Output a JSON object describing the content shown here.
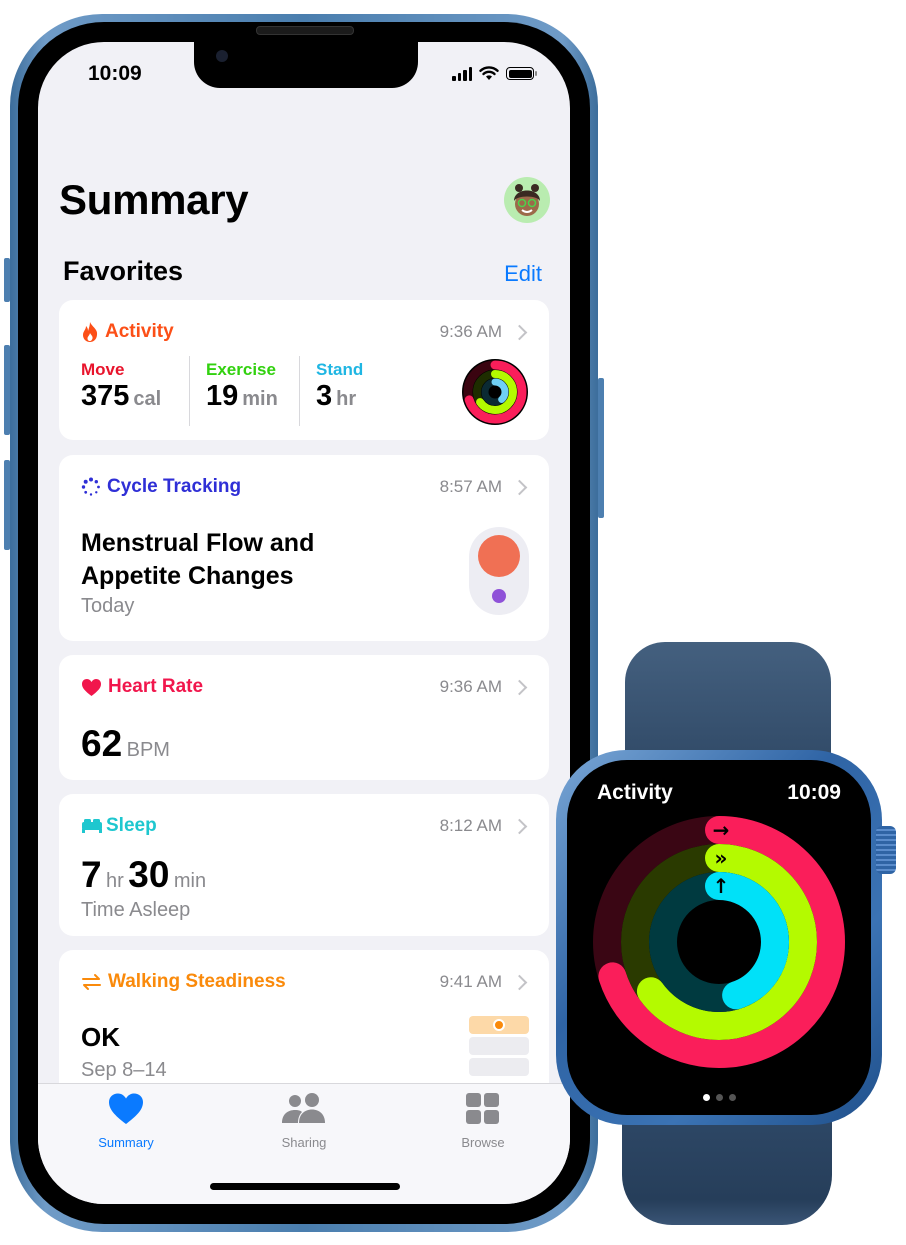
{
  "status_bar": {
    "time": "10:09"
  },
  "header": {
    "title": "Summary"
  },
  "favorites": {
    "label": "Favorites",
    "edit_label": "Edit"
  },
  "cards": {
    "activity": {
      "title": "Activity",
      "time": "9:36 AM",
      "color": "#fc4f17",
      "move": {
        "label": "Move",
        "value": "375",
        "unit": "cal",
        "color": "#e8142c"
      },
      "exercise": {
        "label": "Exercise",
        "value": "19",
        "unit": "min",
        "color": "#32d10f"
      },
      "stand": {
        "label": "Stand",
        "value": "3",
        "unit": "hr",
        "color": "#1fb6e3"
      }
    },
    "cycle": {
      "title": "Cycle Tracking",
      "time": "8:57 AM",
      "color": "#2f2fd6",
      "line1": "Menstrual Flow and",
      "line2": "Appetite Changes",
      "date": "Today"
    },
    "heart": {
      "title": "Heart Rate",
      "time": "9:36 AM",
      "color": "#f1164c",
      "value": "62",
      "unit": "BPM"
    },
    "sleep": {
      "title": "Sleep",
      "time": "8:12 AM",
      "color": "#1ec7cf",
      "hours": "7",
      "hours_unit": "hr",
      "minutes": "30",
      "minutes_unit": "min",
      "caption": "Time Asleep"
    },
    "walking": {
      "title": "Walking Steadiness",
      "time": "9:41 AM",
      "color": "#fa8a0b",
      "value": "OK",
      "date": "Sep 8–14"
    }
  },
  "tabbar": {
    "active_color": "#0a7aff",
    "inactive_color": "#8a8a8e",
    "tabs": [
      {
        "label": "Summary",
        "icon": "heart-icon",
        "active": true
      },
      {
        "label": "Sharing",
        "icon": "people-icon",
        "active": false
      },
      {
        "label": "Browse",
        "icon": "grid-icon",
        "active": false
      }
    ]
  },
  "watch": {
    "title": "Activity",
    "time": "10:09",
    "page_count": 3,
    "active_page": 1,
    "rings": [
      {
        "name": "Move",
        "progress": 0.7,
        "color": "#fa1e5a"
      },
      {
        "name": "Exercise",
        "progress": 0.65,
        "color": "#b4fa00"
      },
      {
        "name": "Stand",
        "progress": 0.45,
        "color": "#00e1f8"
      }
    ]
  }
}
